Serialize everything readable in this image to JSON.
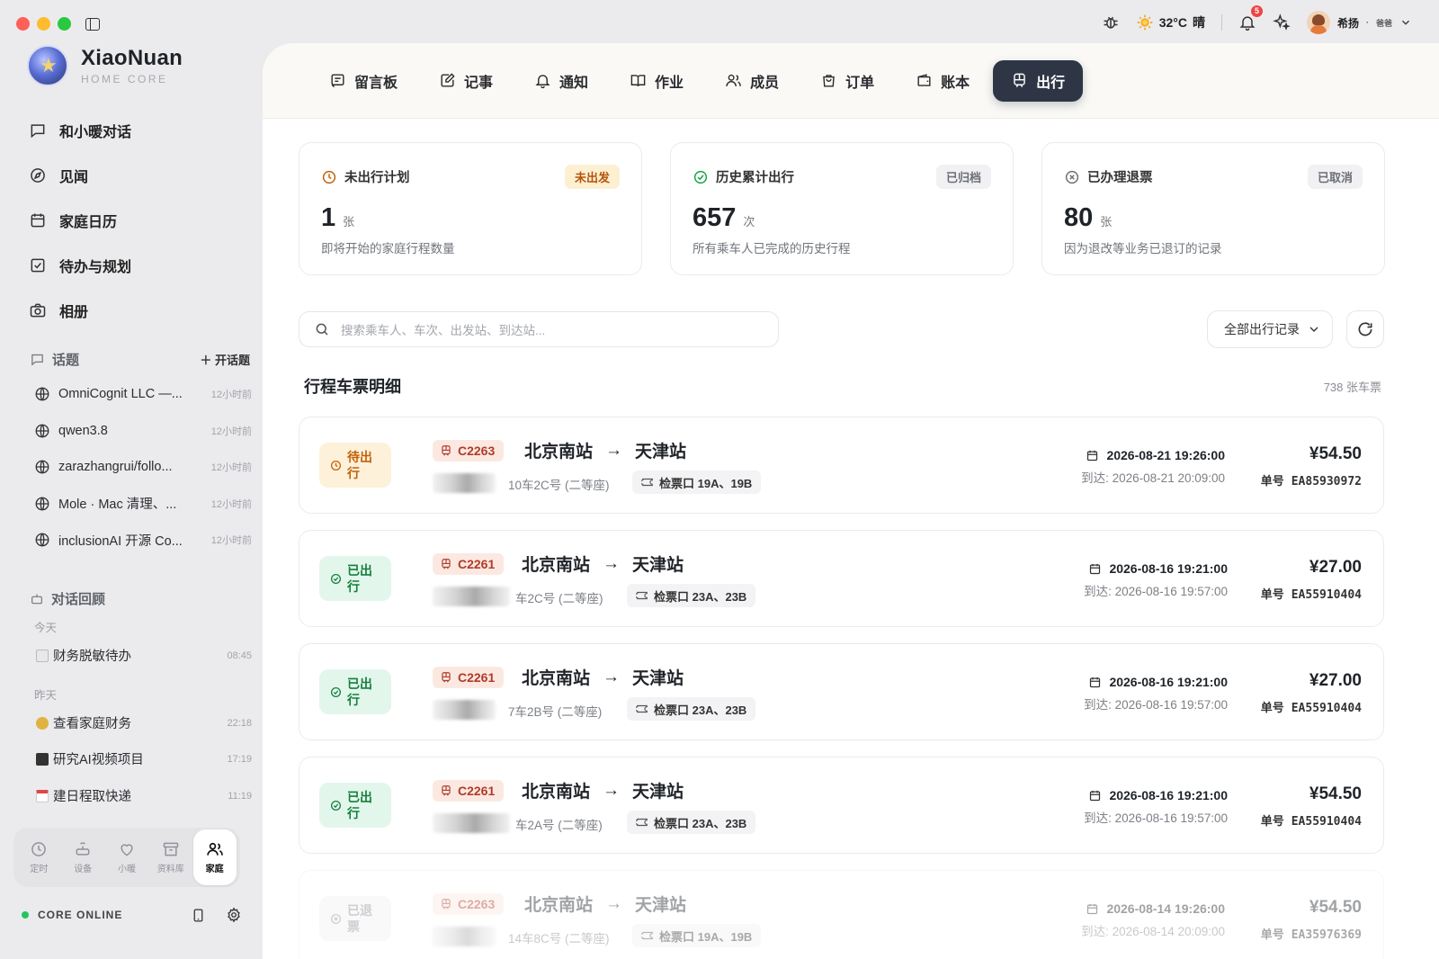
{
  "app": {
    "name": "XiaoNuan",
    "subtitle": "HOME CORE"
  },
  "topbar": {
    "weather_temp": "32°C",
    "weather_desc": "晴",
    "notif_count": "5",
    "user_name": "希扬",
    "user_role": "爸爸"
  },
  "sidebar": {
    "nav": [
      {
        "label": "和小暖对话",
        "icon": "chat-icon"
      },
      {
        "label": "见闻",
        "icon": "compass-icon"
      },
      {
        "label": "家庭日历",
        "icon": "calendar-icon"
      },
      {
        "label": "待办与规划",
        "icon": "checkbox-icon"
      },
      {
        "label": "相册",
        "icon": "camera-icon"
      }
    ],
    "topics_header": "话题",
    "topics_action": "开话题",
    "topics": [
      {
        "title": "OmniCognit LLC —...",
        "time": "12小时前"
      },
      {
        "title": "qwen3.8",
        "time": "12小时前"
      },
      {
        "title": "zarazhangrui/follo...",
        "time": "12小时前"
      },
      {
        "title": "Mole · Mac 清理、...",
        "time": "12小时前"
      },
      {
        "title": "inclusionAI 开源 Co...",
        "time": "12小时前"
      }
    ],
    "review_header": "对话回顾",
    "today_label": "今天",
    "yesterday_label": "昨天",
    "today_items": [
      {
        "title": "财务脱敏待办",
        "time": "08:45"
      }
    ],
    "yesterday_items": [
      {
        "title": "查看家庭财务",
        "time": "22:18"
      },
      {
        "title": "研究AI视频项目",
        "time": "17:19"
      },
      {
        "title": "建日程取快递",
        "time": "11:19"
      }
    ],
    "dock": [
      {
        "label": "定时",
        "icon": "clock-icon"
      },
      {
        "label": "设备",
        "icon": "device-icon"
      },
      {
        "label": "小暖",
        "icon": "heart-icon"
      },
      {
        "label": "资料库",
        "icon": "archive-icon"
      },
      {
        "label": "家庭",
        "icon": "family-icon"
      }
    ],
    "status": "CORE ONLINE"
  },
  "tabs": [
    {
      "label": "留言板",
      "icon": "message-board-icon"
    },
    {
      "label": "记事",
      "icon": "note-icon"
    },
    {
      "label": "通知",
      "icon": "bell-icon"
    },
    {
      "label": "作业",
      "icon": "book-icon"
    },
    {
      "label": "成员",
      "icon": "members-icon"
    },
    {
      "label": "订单",
      "icon": "bag-icon"
    },
    {
      "label": "账本",
      "icon": "wallet-icon"
    },
    {
      "label": "出行",
      "icon": "train-icon",
      "active": true
    }
  ],
  "stats": [
    {
      "title": "未出行计划",
      "pill": "未出发",
      "value": "1",
      "unit": "张",
      "desc": "即将开始的家庭行程数量",
      "color": "#c2620a"
    },
    {
      "title": "历史累计出行",
      "pill": "已归档",
      "value": "657",
      "unit": "次",
      "desc": "所有乘车人已完成的历史行程",
      "color": "#16a34a"
    },
    {
      "title": "已办理退票",
      "pill": "已取消",
      "value": "80",
      "unit": "张",
      "desc": "因为退改等业务已退订的记录",
      "color": "#6b6f76"
    }
  ],
  "search": {
    "placeholder": "搜索乘车人、车次、出发站、到达站..."
  },
  "filter": {
    "selected": "全部出行记录"
  },
  "list": {
    "title": "行程车票明细",
    "count": "738 张车票"
  },
  "tickets": [
    {
      "status": "待出行",
      "type": "pending",
      "train": "C2263",
      "from": "北京南站",
      "to": "天津站",
      "seat": "10车2C号 (二等座)",
      "gate": "检票口 19A、19B",
      "depart": "2026-08-21 19:26:00",
      "arrive": "到达: 2026-08-21 20:09:00",
      "price": "¥54.50",
      "order_label": "单号",
      "order": "EA85930972"
    },
    {
      "status": "已出行",
      "type": "done",
      "train": "C2261",
      "from": "北京南站",
      "to": "天津站",
      "seat": "车2C号 (二等座)",
      "gate": "检票口 23A、23B",
      "depart": "2026-08-16 19:21:00",
      "arrive": "到达: 2026-08-16 19:57:00",
      "price": "¥27.00",
      "order_label": "单号",
      "order": "EA55910404"
    },
    {
      "status": "已出行",
      "type": "done",
      "train": "C2261",
      "from": "北京南站",
      "to": "天津站",
      "seat": "7车2B号 (二等座)",
      "gate": "检票口 23A、23B",
      "depart": "2026-08-16 19:21:00",
      "arrive": "到达: 2026-08-16 19:57:00",
      "price": "¥27.00",
      "order_label": "单号",
      "order": "EA55910404"
    },
    {
      "status": "已出行",
      "type": "done",
      "train": "C2261",
      "from": "北京南站",
      "to": "天津站",
      "seat": "车2A号 (二等座)",
      "gate": "检票口 23A、23B",
      "depart": "2026-08-16 19:21:00",
      "arrive": "到达: 2026-08-16 19:57:00",
      "price": "¥54.50",
      "order_label": "单号",
      "order": "EA55910404"
    },
    {
      "status": "已退票",
      "type": "refund",
      "train": "C2263",
      "from": "北京南站",
      "to": "天津站",
      "seat": "14车8C号 (二等座)",
      "gate": "检票口 19A、19B",
      "depart": "2026-08-14 19:26:00",
      "arrive": "到达: 2026-08-14 20:09:00",
      "price": "¥54.50",
      "order_label": "单号",
      "order": "EA35976369"
    }
  ]
}
